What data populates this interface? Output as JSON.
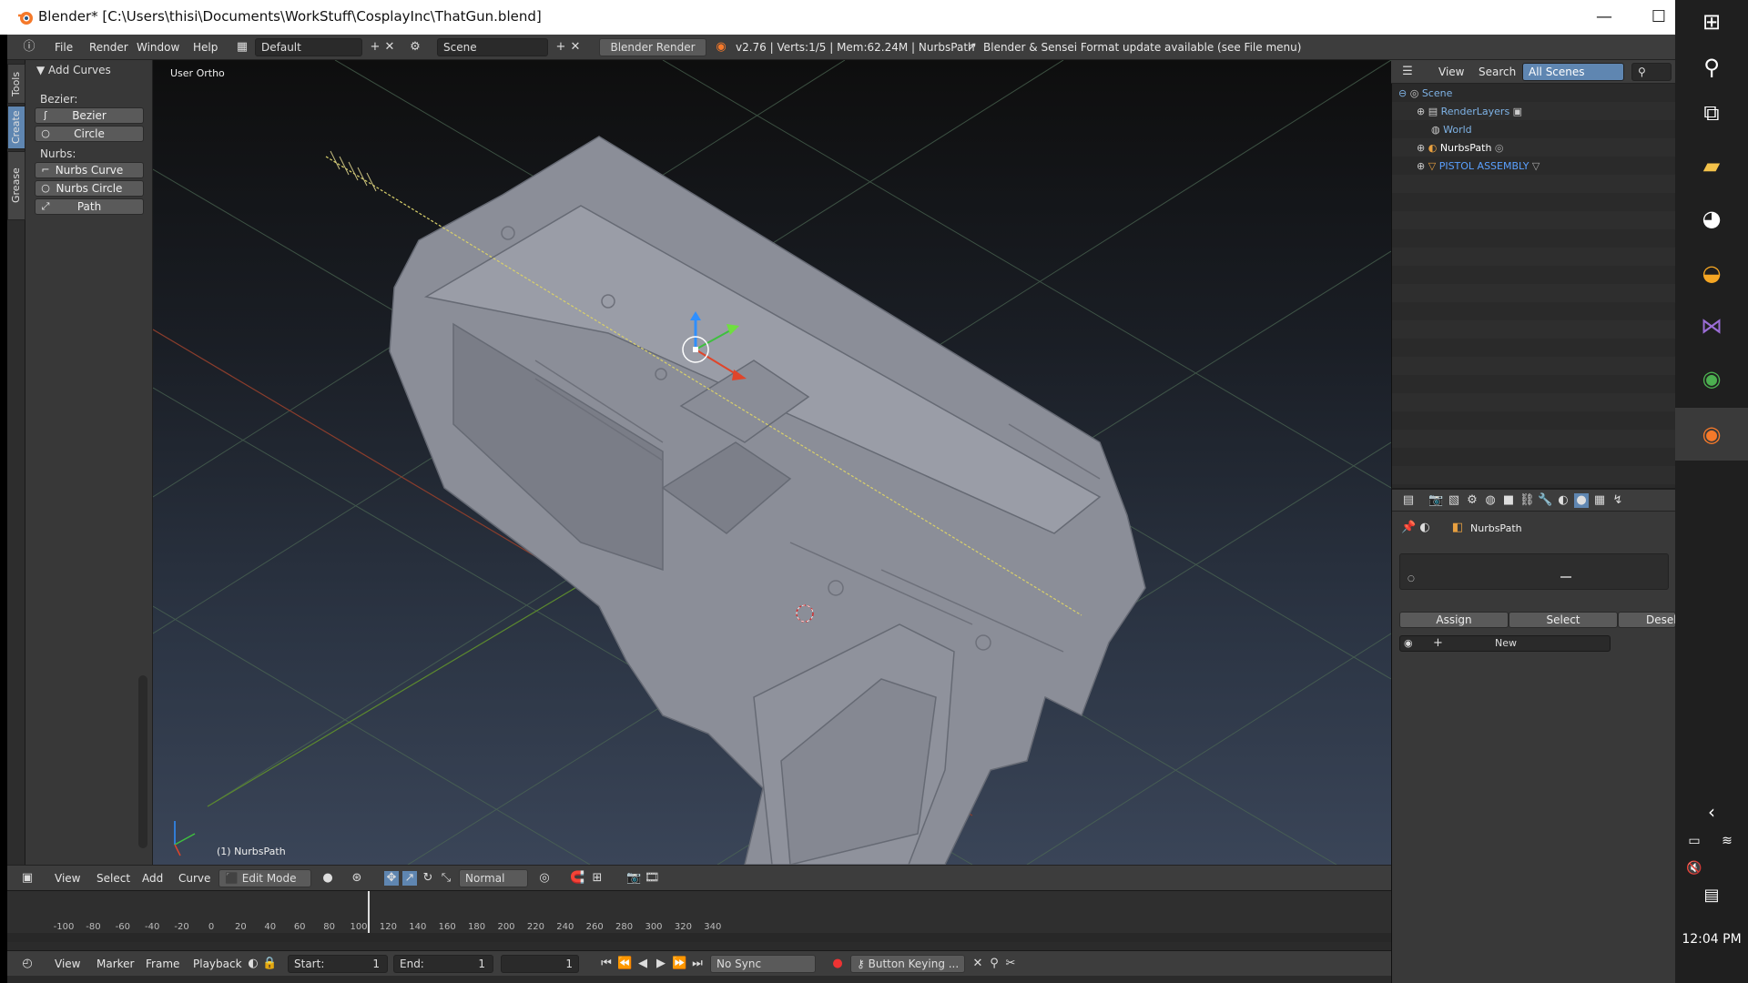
{
  "window": {
    "title": "Blender* [C:\\Users\\thisi\\Documents\\WorkStuff\\CosplayInc\\ThatGun.blend]",
    "min": "—",
    "max": "☐",
    "close": "✕"
  },
  "info_bar": {
    "menus": [
      "File",
      "Render",
      "Window",
      "Help"
    ],
    "layout_field": "Default",
    "scene_field": "Scene",
    "engine": "Blender Render",
    "stats": "v2.76 | Verts:1/5 | Mem:62.24M | NurbsPath",
    "update_notice": "Blender & Sensei Format update available (see File menu)"
  },
  "side_tabs": [
    "Tools",
    "Create",
    "Grease Pencil"
  ],
  "tool_shelf": {
    "panel_title": "Add Curves",
    "bezier_label": "Bezier:",
    "bezier_items": [
      "Bezier",
      "Circle"
    ],
    "nurbs_label": "Nurbs:",
    "nurbs_items": [
      "Nurbs Curve",
      "Nurbs Circle",
      "Path"
    ]
  },
  "viewport": {
    "view_name": "User Ortho",
    "object_label": "(1) NurbsPath"
  },
  "viewport_header": {
    "menus": [
      "View",
      "Select",
      "Add",
      "Curve"
    ],
    "mode": "Edit Mode",
    "pivot": "Normal"
  },
  "timeline": {
    "ticks": [
      "-100",
      "-80",
      "-60",
      "-40",
      "-20",
      "0",
      "20",
      "40",
      "60",
      "80",
      "100",
      "120",
      "140",
      "160",
      "180",
      "200",
      "220",
      "240",
      "260",
      "280",
      "300",
      "320",
      "340"
    ],
    "current_frame_marker": 0
  },
  "timeline_header": {
    "menus": [
      "View",
      "Marker",
      "Frame",
      "Playback"
    ],
    "start_label": "Start:",
    "start_value": "1",
    "end_label": "End:",
    "end_value": "1",
    "current_value": "1",
    "sync": "No Sync",
    "keying": "Button Keying ..."
  },
  "outliner": {
    "menus": [
      "View",
      "Search"
    ],
    "filter": "All Scenes",
    "items": [
      {
        "name": "Scene",
        "indent": 0,
        "color": "#7fb3e6"
      },
      {
        "name": "RenderLayers",
        "indent": 1,
        "color": "#7fb3e6"
      },
      {
        "name": "World",
        "indent": 1,
        "color": "#7fb3e6"
      },
      {
        "name": "NurbsPath",
        "indent": 1,
        "color": "#ffffff"
      },
      {
        "name": "PISTOL ASSEMBLY",
        "indent": 1,
        "color": "#5aa0ff"
      }
    ]
  },
  "properties": {
    "object_name": "NurbsPath",
    "buttons": [
      "Assign",
      "Select",
      "Deselect"
    ],
    "new_label": "New"
  },
  "taskbar": {
    "time": "12:04 PM"
  },
  "colors": {
    "accent": "#5f86b1",
    "selection": "#f5a623"
  }
}
